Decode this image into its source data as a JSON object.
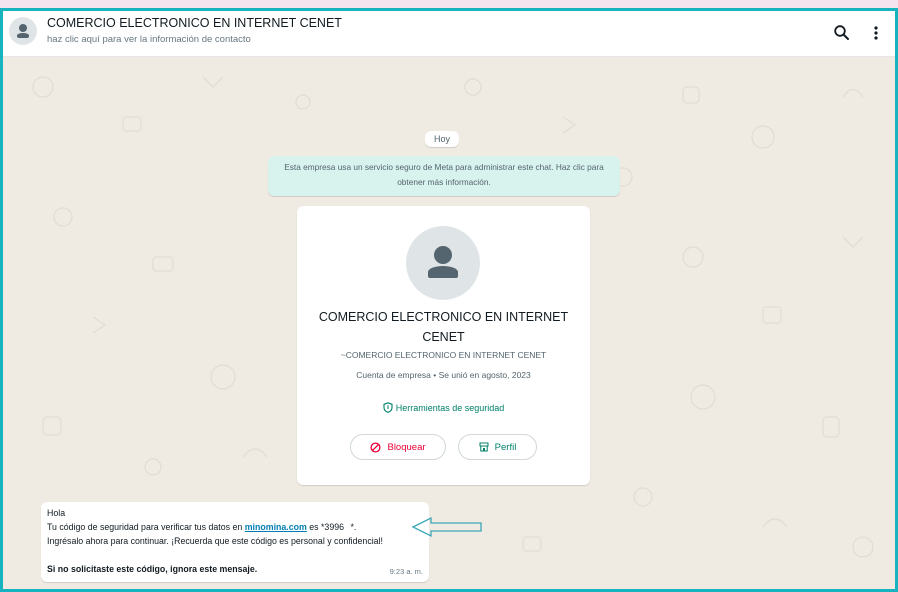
{
  "header": {
    "title": "COMERCIO ELECTRONICO EN INTERNET CENET",
    "subtitle": "haz clic aquí para ver la información de contacto",
    "icons": [
      "person-icon",
      "search-icon",
      "kebab-menu-icon"
    ]
  },
  "chat": {
    "date_chip": "Hoy",
    "encryption_notice": "Esta empresa usa un servicio seguro de Meta para administrar este chat. Haz clic para obtener más información."
  },
  "contact_card": {
    "name": "COMERCIO ELECTRONICO EN INTERNET CENET",
    "handle": "~COMERCIO ELECTRONICO EN INTERNET CENET",
    "account_info": "Cuenta de empresa • Se unió en agosto, 2023",
    "security_tools": "Herramientas de seguridad",
    "block_label": "Bloquear",
    "profile_label": "Perfil"
  },
  "message": {
    "greeting": "Hola",
    "line1_prefix": "Tu código de seguridad para verificar tus datos en",
    "link": "minomina.com",
    "line1_middle": "es *3996",
    "line1_suffix": "*.",
    "line2": "Ingrésalo ahora para continuar. ¡Recuerda que este código es personal y confidencial!",
    "line3": "Si no solicitaste este código, ignora este mensaje.",
    "time": "9:23 a. m."
  },
  "colors": {
    "frame_border": "#17b3be",
    "chat_background": "#efeae2",
    "accent_green": "#008069",
    "danger_red": "#ea0038",
    "notice_background": "#d8f2ee",
    "arrow_color": "#3aa7b8"
  }
}
